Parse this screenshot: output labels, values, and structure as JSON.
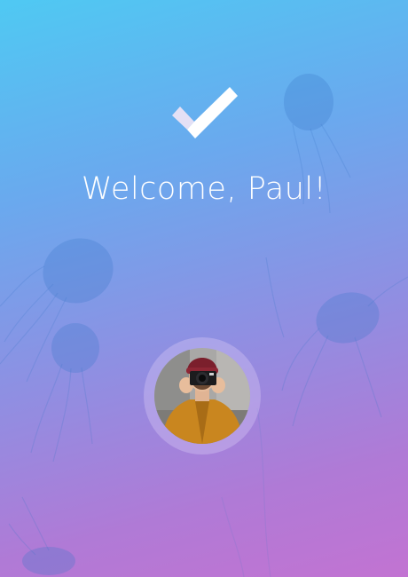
{
  "screen": {
    "welcome_text": "Welcome, Paul!"
  },
  "icons": {
    "success": "checkmark-icon"
  },
  "avatar": {
    "kind": "user-photo"
  },
  "colors": {
    "gradient_top": "#4fc9f3",
    "gradient_bottom": "#c273d2",
    "text": "#ffffff",
    "check_light": "#ffffff",
    "check_shade": "#e4e0f5"
  }
}
